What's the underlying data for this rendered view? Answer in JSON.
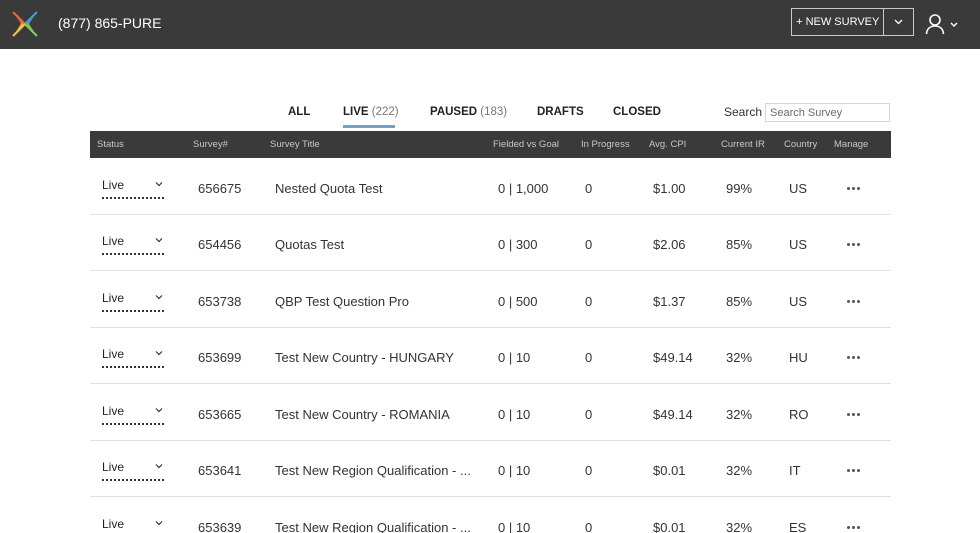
{
  "header": {
    "phone": "(877) 865-PURE",
    "new_survey_label": "+ NEW SURVEY"
  },
  "tabs": [
    {
      "label": "ALL",
      "count": ""
    },
    {
      "label": "LIVE",
      "count": "(222)",
      "active": true
    },
    {
      "label": "PAUSED",
      "count": "(183)"
    },
    {
      "label": "DRAFTS",
      "count": ""
    },
    {
      "label": "CLOSED",
      "count": ""
    }
  ],
  "search": {
    "label": "Search",
    "placeholder": "Search Survey"
  },
  "table": {
    "columns": [
      "Status",
      "Survey#",
      "Survey Title",
      "Fielded vs Goal",
      "In Progress",
      "Avg. CPI",
      "Current IR",
      "Country",
      "Manage"
    ],
    "rows": [
      {
        "status": "Live",
        "survey": "656675",
        "title": "Nested Quota Test",
        "fielded": "0 | 1,000",
        "progress": "0",
        "cpi": "$1.00",
        "ir": "99%",
        "country": "US"
      },
      {
        "status": "Live",
        "survey": "654456",
        "title": "Quotas Test",
        "fielded": "0 | 300",
        "progress": "0",
        "cpi": "$2.06",
        "ir": "85%",
        "country": "US"
      },
      {
        "status": "Live",
        "survey": "653738",
        "title": "QBP Test Question Pro",
        "fielded": "0 | 500",
        "progress": "0",
        "cpi": "$1.37",
        "ir": "85%",
        "country": "US"
      },
      {
        "status": "Live",
        "survey": "653699",
        "title": "Test New Country - HUNGARY",
        "fielded": "0 | 10",
        "progress": "0",
        "cpi": "$49.14",
        "ir": "32%",
        "country": "HU"
      },
      {
        "status": "Live",
        "survey": "653665",
        "title": "Test New Country - ROMANIA",
        "fielded": "0 | 10",
        "progress": "0",
        "cpi": "$49.14",
        "ir": "32%",
        "country": "RO"
      },
      {
        "status": "Live",
        "survey": "653641",
        "title": "Test New Region Qualification - ...",
        "fielded": "0 | 10",
        "progress": "0",
        "cpi": "$0.01",
        "ir": "32%",
        "country": "IT"
      },
      {
        "status": "Live",
        "survey": "653639",
        "title": "Test New Region Qualification - ...",
        "fielded": "0 | 10",
        "progress": "0",
        "cpi": "$0.01",
        "ir": "32%",
        "country": "ES"
      }
    ]
  },
  "colors": {
    "topbar": "#3a3a3a",
    "tab_underline": "#6fa3c9",
    "logo_red": "#d94a38",
    "logo_yellow": "#e8b23a",
    "logo_blue": "#3a8fc6",
    "logo_green": "#7ab648"
  },
  "icons": {
    "logo": "pure-spectrum-logo",
    "user": "user-icon",
    "caret": "chevron-down-icon",
    "manage": "more-horizontal-icon"
  }
}
